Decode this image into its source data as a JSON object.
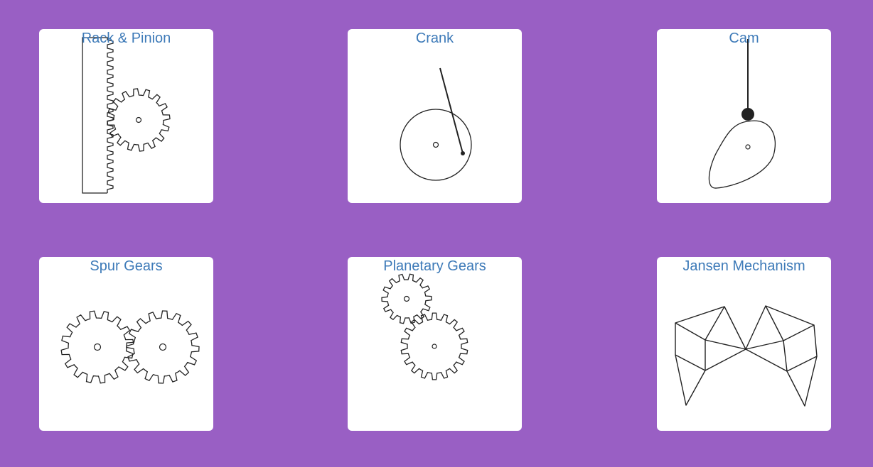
{
  "page": {
    "background_color": "#995fc4",
    "card_color": "#ffffff",
    "title_color": "#3d7ab8",
    "stroke_color": "#222222"
  },
  "cards": [
    {
      "id": "rack-pinion",
      "title": "Rack & Pinion"
    },
    {
      "id": "crank",
      "title": "Crank"
    },
    {
      "id": "cam",
      "title": "Cam"
    },
    {
      "id": "spur-gears",
      "title": "Spur Gears"
    },
    {
      "id": "planetary-gears",
      "title": "Planetary Gears"
    },
    {
      "id": "jansen-mechanism",
      "title": "Jansen Mechanism"
    }
  ]
}
